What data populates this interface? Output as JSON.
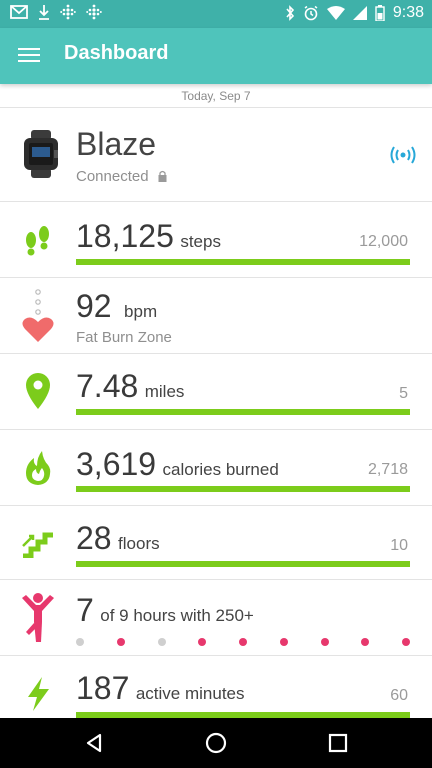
{
  "status_bar": {
    "time": "9:38",
    "left_icons": [
      "gmail-icon",
      "download-icon",
      "fitbit-icon",
      "fitbit-icon"
    ],
    "right_icons": [
      "bluetooth-icon",
      "alarm-icon",
      "wifi-icon",
      "signal-icon",
      "battery-icon"
    ]
  },
  "app_bar": {
    "title": "Dashboard",
    "menu_icon": "hamburger-menu-icon"
  },
  "date_label": "Today, Sep 7",
  "device": {
    "name": "Blaze",
    "status": "Connected",
    "icon": "watch-icon",
    "sync_icon": "sync-signal-icon"
  },
  "steps": {
    "value": "18,125",
    "unit": "steps",
    "goal": "12,000",
    "progress": 1.0,
    "icon": "footsteps-icon"
  },
  "heart": {
    "value": "92",
    "unit": "bpm",
    "zone": "Fat Burn Zone",
    "icon": "heart-icon"
  },
  "distance": {
    "value": "7.48",
    "unit": "miles",
    "goal": "5",
    "progress": 1.0,
    "icon": "location-pin-icon"
  },
  "calories": {
    "value": "3,619",
    "unit": "calories burned",
    "goal": "2,718",
    "progress": 1.0,
    "icon": "flame-icon"
  },
  "floors": {
    "value": "28",
    "unit": "floors",
    "goal": "10",
    "progress": 1.0,
    "icon": "stairs-icon"
  },
  "hourly": {
    "value": "7",
    "text": "of 9 hours with 250+",
    "icon": "person-active-icon",
    "hours": [
      false,
      true,
      false,
      true,
      true,
      true,
      true,
      true,
      true
    ]
  },
  "active": {
    "value": "187",
    "unit": "active minutes",
    "goal": "60",
    "progress": 1.0,
    "icon": "lightning-icon"
  },
  "colors": {
    "teal": "#4fc4bb",
    "status_teal": "#3fb1a9",
    "green": "#7ccc1b",
    "pink": "#e7386d",
    "heart": "#f06b6b",
    "sync_blue": "#27a8d8",
    "dot_gray": "#cfcfcf"
  },
  "nav": {
    "back_icon": "back-triangle-icon",
    "home_icon": "home-circle-icon",
    "recents_icon": "recents-square-icon"
  }
}
